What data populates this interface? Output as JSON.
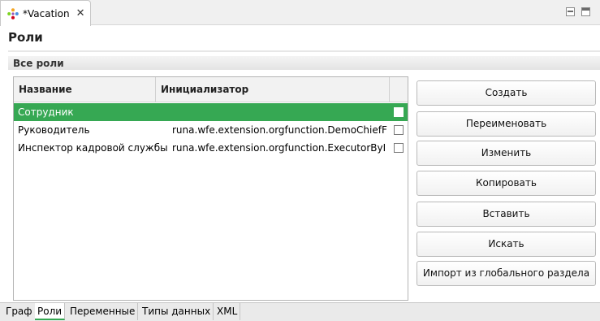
{
  "editor_tab": {
    "title": "*Vacation",
    "close_label": "✕",
    "icon": "flower-process-icon"
  },
  "window_controls": {
    "minimize": "minimize-icon",
    "maximize": "maximize-icon"
  },
  "page": {
    "title": "Роли"
  },
  "section": {
    "title": "Все роли"
  },
  "table": {
    "columns": [
      "Название",
      "Инициализатор",
      ""
    ],
    "rows": [
      {
        "name": "Сотрудник",
        "initializer": "",
        "checked": false,
        "selected": true
      },
      {
        "name": "Руководитель",
        "initializer": "runa.wfe.extension.orgfunction.DemoChiefF",
        "checked": false,
        "selected": false
      },
      {
        "name": "Инспектор кадровой службы",
        "initializer": "runa.wfe.extension.orgfunction.ExecutorByI",
        "checked": false,
        "selected": false
      }
    ]
  },
  "buttons": {
    "create": "Создать",
    "rename": "Переименовать",
    "edit": "Изменить",
    "copy": "Копировать",
    "paste": "Вставить",
    "search": "Искать",
    "import": "Импорт из глобального раздела"
  },
  "bottom_tabs": [
    {
      "label": "Граф",
      "active": false
    },
    {
      "label": "Роли",
      "active": true
    },
    {
      "label": "Переменные",
      "active": false
    },
    {
      "label": "Типы данных",
      "active": false
    },
    {
      "label": "XML",
      "active": false
    }
  ],
  "colors": {
    "selection": "#36a853",
    "active_tab_underline": "#36a853"
  }
}
